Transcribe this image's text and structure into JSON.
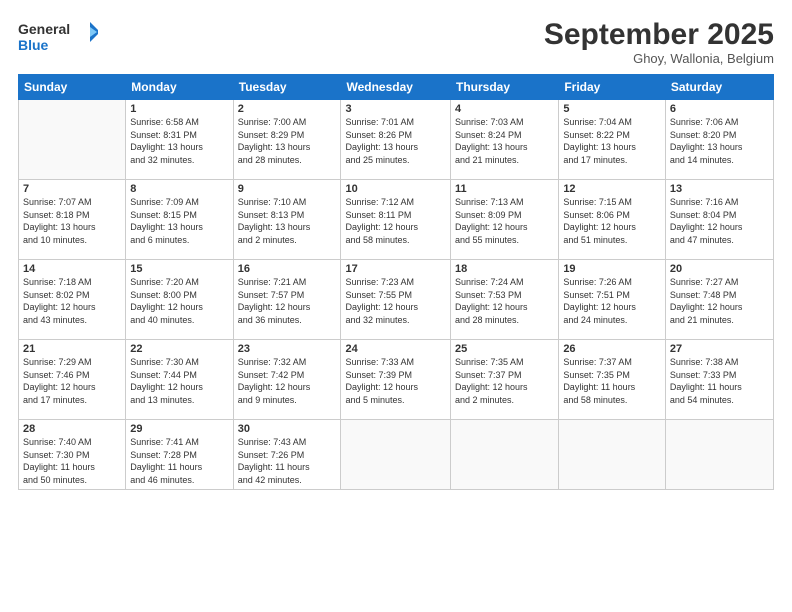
{
  "logo": {
    "line1": "General",
    "line2": "Blue"
  },
  "header": {
    "month": "September 2025",
    "location": "Ghoy, Wallonia, Belgium"
  },
  "days_of_week": [
    "Sunday",
    "Monday",
    "Tuesday",
    "Wednesday",
    "Thursday",
    "Friday",
    "Saturday"
  ],
  "weeks": [
    [
      {
        "day": "",
        "info": ""
      },
      {
        "day": "1",
        "info": "Sunrise: 6:58 AM\nSunset: 8:31 PM\nDaylight: 13 hours\nand 32 minutes."
      },
      {
        "day": "2",
        "info": "Sunrise: 7:00 AM\nSunset: 8:29 PM\nDaylight: 13 hours\nand 28 minutes."
      },
      {
        "day": "3",
        "info": "Sunrise: 7:01 AM\nSunset: 8:26 PM\nDaylight: 13 hours\nand 25 minutes."
      },
      {
        "day": "4",
        "info": "Sunrise: 7:03 AM\nSunset: 8:24 PM\nDaylight: 13 hours\nand 21 minutes."
      },
      {
        "day": "5",
        "info": "Sunrise: 7:04 AM\nSunset: 8:22 PM\nDaylight: 13 hours\nand 17 minutes."
      },
      {
        "day": "6",
        "info": "Sunrise: 7:06 AM\nSunset: 8:20 PM\nDaylight: 13 hours\nand 14 minutes."
      }
    ],
    [
      {
        "day": "7",
        "info": "Sunrise: 7:07 AM\nSunset: 8:18 PM\nDaylight: 13 hours\nand 10 minutes."
      },
      {
        "day": "8",
        "info": "Sunrise: 7:09 AM\nSunset: 8:15 PM\nDaylight: 13 hours\nand 6 minutes."
      },
      {
        "day": "9",
        "info": "Sunrise: 7:10 AM\nSunset: 8:13 PM\nDaylight: 13 hours\nand 2 minutes."
      },
      {
        "day": "10",
        "info": "Sunrise: 7:12 AM\nSunset: 8:11 PM\nDaylight: 12 hours\nand 58 minutes."
      },
      {
        "day": "11",
        "info": "Sunrise: 7:13 AM\nSunset: 8:09 PM\nDaylight: 12 hours\nand 55 minutes."
      },
      {
        "day": "12",
        "info": "Sunrise: 7:15 AM\nSunset: 8:06 PM\nDaylight: 12 hours\nand 51 minutes."
      },
      {
        "day": "13",
        "info": "Sunrise: 7:16 AM\nSunset: 8:04 PM\nDaylight: 12 hours\nand 47 minutes."
      }
    ],
    [
      {
        "day": "14",
        "info": "Sunrise: 7:18 AM\nSunset: 8:02 PM\nDaylight: 12 hours\nand 43 minutes."
      },
      {
        "day": "15",
        "info": "Sunrise: 7:20 AM\nSunset: 8:00 PM\nDaylight: 12 hours\nand 40 minutes."
      },
      {
        "day": "16",
        "info": "Sunrise: 7:21 AM\nSunset: 7:57 PM\nDaylight: 12 hours\nand 36 minutes."
      },
      {
        "day": "17",
        "info": "Sunrise: 7:23 AM\nSunset: 7:55 PM\nDaylight: 12 hours\nand 32 minutes."
      },
      {
        "day": "18",
        "info": "Sunrise: 7:24 AM\nSunset: 7:53 PM\nDaylight: 12 hours\nand 28 minutes."
      },
      {
        "day": "19",
        "info": "Sunrise: 7:26 AM\nSunset: 7:51 PM\nDaylight: 12 hours\nand 24 minutes."
      },
      {
        "day": "20",
        "info": "Sunrise: 7:27 AM\nSunset: 7:48 PM\nDaylight: 12 hours\nand 21 minutes."
      }
    ],
    [
      {
        "day": "21",
        "info": "Sunrise: 7:29 AM\nSunset: 7:46 PM\nDaylight: 12 hours\nand 17 minutes."
      },
      {
        "day": "22",
        "info": "Sunrise: 7:30 AM\nSunset: 7:44 PM\nDaylight: 12 hours\nand 13 minutes."
      },
      {
        "day": "23",
        "info": "Sunrise: 7:32 AM\nSunset: 7:42 PM\nDaylight: 12 hours\nand 9 minutes."
      },
      {
        "day": "24",
        "info": "Sunrise: 7:33 AM\nSunset: 7:39 PM\nDaylight: 12 hours\nand 5 minutes."
      },
      {
        "day": "25",
        "info": "Sunrise: 7:35 AM\nSunset: 7:37 PM\nDaylight: 12 hours\nand 2 minutes."
      },
      {
        "day": "26",
        "info": "Sunrise: 7:37 AM\nSunset: 7:35 PM\nDaylight: 11 hours\nand 58 minutes."
      },
      {
        "day": "27",
        "info": "Sunrise: 7:38 AM\nSunset: 7:33 PM\nDaylight: 11 hours\nand 54 minutes."
      }
    ],
    [
      {
        "day": "28",
        "info": "Sunrise: 7:40 AM\nSunset: 7:30 PM\nDaylight: 11 hours\nand 50 minutes."
      },
      {
        "day": "29",
        "info": "Sunrise: 7:41 AM\nSunset: 7:28 PM\nDaylight: 11 hours\nand 46 minutes."
      },
      {
        "day": "30",
        "info": "Sunrise: 7:43 AM\nSunset: 7:26 PM\nDaylight: 11 hours\nand 42 minutes."
      },
      {
        "day": "",
        "info": ""
      },
      {
        "day": "",
        "info": ""
      },
      {
        "day": "",
        "info": ""
      },
      {
        "day": "",
        "info": ""
      }
    ]
  ]
}
